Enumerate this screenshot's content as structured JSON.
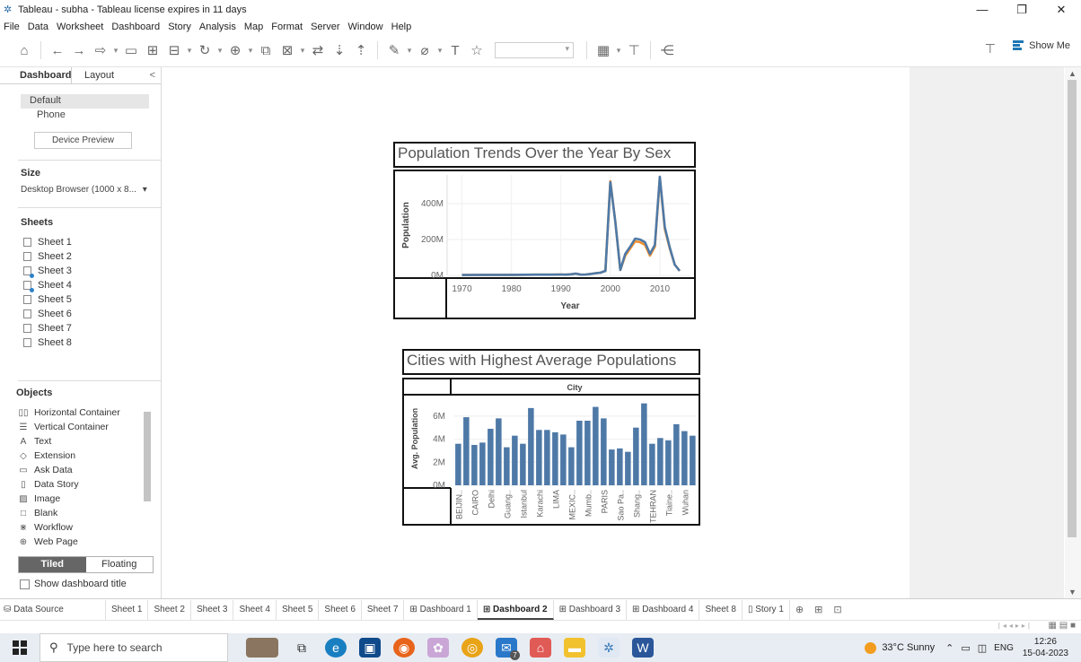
{
  "window": {
    "title": "Tableau - subha - Tableau license expires in 11 days",
    "minimize": "—",
    "restore": "❐",
    "close": "✕"
  },
  "menu": [
    "File",
    "Data",
    "Worksheet",
    "Dashboard",
    "Story",
    "Analysis",
    "Map",
    "Format",
    "Server",
    "Window",
    "Help"
  ],
  "toolbar": {
    "show_me_label": "Show Me"
  },
  "left_panel": {
    "tabs": {
      "dashboard": "Dashboard",
      "layout": "Layout",
      "collapse": "<"
    },
    "devices": [
      "Default",
      "Phone"
    ],
    "device_preview_button": "Device Preview",
    "size": {
      "header": "Size",
      "value": "Desktop Browser (1000 x 8...",
      "arrow": "▾"
    },
    "sheets": {
      "header": "Sheets",
      "items": [
        "Sheet 1",
        "Sheet 2",
        "Sheet 3",
        "Sheet 4",
        "Sheet 5",
        "Sheet 6",
        "Sheet 7",
        "Sheet 8"
      ]
    },
    "objects": {
      "header": "Objects",
      "items": [
        "Horizontal Container",
        "Vertical Container",
        "Text",
        "Extension",
        "Ask Data",
        "Data Story",
        "Image",
        "Blank",
        "Workflow",
        "Web Page"
      ]
    },
    "tiled_label": "Tiled",
    "floating_label": "Floating",
    "show_title_label": "Show dashboard title"
  },
  "charts": {
    "line_title": "Population Trends Over the Year By Sex",
    "bar_title": "Cities with Highest Average Populations"
  },
  "chart_data": [
    {
      "type": "line",
      "title": "Population Trends Over the Year By Sex",
      "xlabel": "Year",
      "ylabel": "Population",
      "xlim": [
        1967,
        2016
      ],
      "ylim": [
        0,
        560
      ],
      "y_unit": "M",
      "x_ticks": [
        "1970",
        "1980",
        "1990",
        "2000",
        "2010"
      ],
      "y_ticks": [
        "0M",
        "200M",
        "400M"
      ],
      "x_tick_values": [
        1970,
        1980,
        1990,
        2000,
        2010
      ],
      "y_tick_values": [
        0,
        200,
        400
      ],
      "series": [
        {
          "color": "#f28e2b",
          "x": [
            1970,
            1975,
            1980,
            1985,
            1988,
            1990,
            1991,
            1992,
            1993,
            1994,
            1995,
            1996,
            1997,
            1998,
            1999,
            2000,
            2001,
            2002,
            2003,
            2004,
            2005,
            2006,
            2007,
            2008,
            2009,
            2010,
            2011,
            2012,
            2013,
            2014
          ],
          "values": [
            2,
            3,
            3,
            4,
            4,
            5,
            4,
            6,
            10,
            4,
            5,
            8,
            12,
            15,
            25,
            525,
            300,
            30,
            110,
            150,
            190,
            185,
            170,
            110,
            160,
            545,
            260,
            150,
            60,
            25
          ]
        },
        {
          "color": "#4e79a7",
          "x": [
            1970,
            1975,
            1980,
            1985,
            1988,
            1990,
            1991,
            1992,
            1993,
            1994,
            1995,
            1996,
            1997,
            1998,
            1999,
            2000,
            2001,
            2002,
            2003,
            2004,
            2005,
            2006,
            2007,
            2008,
            2009,
            2010,
            2011,
            2012,
            2013,
            2014
          ],
          "values": [
            2,
            3,
            3,
            4,
            4,
            5,
            4,
            6,
            10,
            4,
            5,
            8,
            12,
            15,
            25,
            520,
            300,
            30,
            120,
            160,
            205,
            200,
            185,
            120,
            170,
            550,
            270,
            155,
            60,
            25
          ]
        }
      ]
    },
    {
      "type": "bar",
      "title": "Cities with Highest Average Populations",
      "column_header": "City",
      "ylabel": "Avg. Population",
      "y_unit": "M",
      "ylim": [
        0,
        7
      ],
      "y_ticks": [
        "0M",
        "2M",
        "4M",
        "6M"
      ],
      "y_tick_values": [
        0,
        2,
        4,
        6
      ],
      "color": "#4e79a7",
      "bar_count": 28,
      "values": [
        3.6,
        5.9,
        3.5,
        3.7,
        4.9,
        5.8,
        3.3,
        4.3,
        3.6,
        6.7,
        4.8,
        4.8,
        4.6,
        4.4,
        3.3,
        5.6,
        5.6,
        6.8,
        5.8,
        3.1,
        3.2,
        2.9,
        5.0,
        7.1,
        3.6,
        4.1,
        3.9,
        5.3,
        4.7,
        4.3
      ],
      "labels": [
        "BEIJIN..",
        "CAIRO",
        "Delhi",
        "Guang..",
        "Istanbul",
        "Karachi",
        "LIMA",
        "MEXIC..",
        "Mumb..",
        "PARIS",
        "Sao Pa..",
        "Shang..",
        "TEHRAN",
        "Tiaine..",
        "Wuhan"
      ]
    }
  ],
  "sheet_tabs": {
    "data_source": "Data Source",
    "tabs": [
      {
        "label": "Sheet 1",
        "type": "sheet",
        "active": false
      },
      {
        "label": "Sheet 2",
        "type": "sheet",
        "active": false
      },
      {
        "label": "Sheet 3",
        "type": "sheet",
        "active": false
      },
      {
        "label": "Sheet 4",
        "type": "sheet",
        "active": false
      },
      {
        "label": "Sheet 5",
        "type": "sheet",
        "active": false
      },
      {
        "label": "Sheet 6",
        "type": "sheet",
        "active": false
      },
      {
        "label": "Sheet 7",
        "type": "sheet",
        "active": false
      },
      {
        "label": "Dashboard 1",
        "type": "dashboard",
        "active": false
      },
      {
        "label": "Dashboard 2",
        "type": "dashboard",
        "active": true
      },
      {
        "label": "Dashboard 3",
        "type": "dashboard",
        "active": false
      },
      {
        "label": "Dashboard 4",
        "type": "dashboard",
        "active": false
      },
      {
        "label": "Sheet 8",
        "type": "sheet",
        "active": false
      },
      {
        "label": "Story 1",
        "type": "story",
        "active": false
      }
    ]
  },
  "taskbar": {
    "search_placeholder": "Type here to search",
    "weather": "33°C  Sunny",
    "language": "ENG",
    "time": "12:26",
    "date": "15-04-2023",
    "badge": "7"
  }
}
